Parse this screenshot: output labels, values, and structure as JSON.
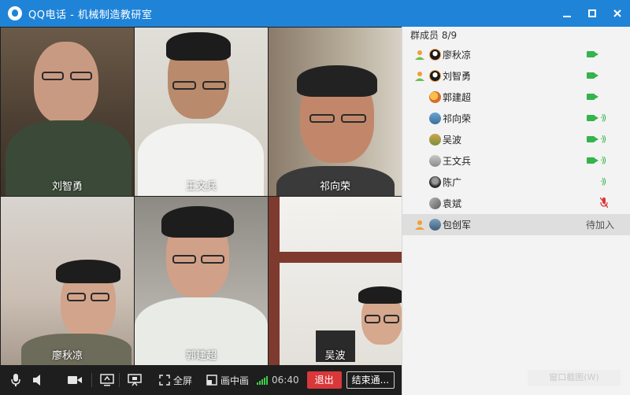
{
  "window": {
    "title": "QQ电话 - 机械制造教研室",
    "controls": [
      "minimize",
      "maximize",
      "close"
    ]
  },
  "videos": [
    {
      "name": "刘智勇"
    },
    {
      "name": "王文兵"
    },
    {
      "name": "祁向荣"
    },
    {
      "name": "廖秋凉"
    },
    {
      "name": "郭建超"
    },
    {
      "name": "吴波"
    }
  ],
  "toolbar": {
    "mic_icon": "microphone-icon",
    "speaker_icon": "speaker-icon",
    "camera_icon": "camera-icon",
    "share_icon": "screen-share-icon",
    "whiteboard_icon": "presentation-icon",
    "fullscreen_label": "全屏",
    "pip_label": "画中画",
    "duration": "06:40",
    "exit_label": "退出",
    "end_label": "结束通..."
  },
  "panel": {
    "member_count": "群成员 8/9",
    "members": [
      {
        "name": "廖秋凉",
        "icon": "admin-person-icon",
        "video": true,
        "speaking": false
      },
      {
        "name": "刘智勇",
        "icon": "admin-person-icon",
        "video": true,
        "speaking": false
      },
      {
        "name": "郭建超",
        "video": true,
        "speaking": false
      },
      {
        "name": "祁向荣",
        "video": true,
        "speaking": true
      },
      {
        "name": "吴波",
        "video": true,
        "speaking": true
      },
      {
        "name": "王文兵",
        "video": true,
        "speaking": true
      },
      {
        "name": "陈广",
        "video": false,
        "speaking": true
      },
      {
        "name": "袁斌",
        "video": false,
        "muted": true
      },
      {
        "name": "包创军",
        "icon": "admin-person-icon",
        "status": "待加入"
      }
    ]
  },
  "watermark": "窗口截图(W)",
  "colors": {
    "titlebar": "#1f84d8",
    "toolbar": "#1e1e1e",
    "exit": "#d9383b",
    "active_green": "#34b44a",
    "panel_bg": "#f3f3f3"
  }
}
